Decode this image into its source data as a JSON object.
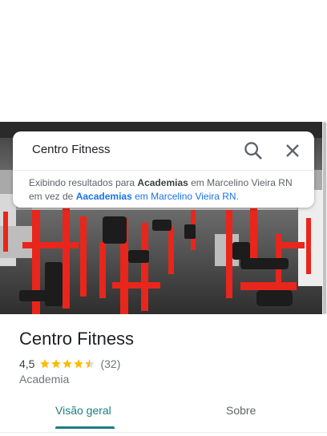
{
  "search": {
    "query": "Centro Fitness"
  },
  "notice": {
    "prefix": "Exibindo resultados para ",
    "result_term": "Academias",
    "middle": " em Marcelino Vieira RN em vez de ",
    "original_term": "Aacademias",
    "original_suffix": " em Marcelino Vieira RN",
    "end": "."
  },
  "place": {
    "name": "Centro Fitness",
    "rating": "4,5",
    "stars_value": 4.5,
    "review_count": "(32)",
    "category": "Academia"
  },
  "tabs": [
    {
      "label": "Visão geral",
      "active": true
    },
    {
      "label": "Sobre",
      "active": false
    }
  ],
  "colors": {
    "accent": "#1e7d82",
    "star": "#fbbc04",
    "link": "#1a73e8",
    "equipment_red": "#e8261c"
  },
  "icons": {
    "search": "search-icon",
    "close": "close-icon",
    "star": "star-icon"
  }
}
